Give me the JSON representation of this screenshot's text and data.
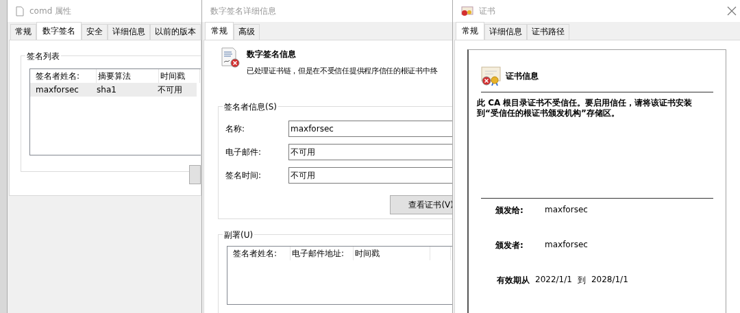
{
  "properties_window": {
    "title": "comd 属性",
    "tabs": [
      {
        "label": "常规",
        "selected": false
      },
      {
        "label": "数字签名",
        "selected": true
      },
      {
        "label": "安全",
        "selected": false
      },
      {
        "label": "详细信息",
        "selected": false
      },
      {
        "label": "以前的版本",
        "selected": false
      }
    ],
    "group_title": "签名列表",
    "signature_list": {
      "columns": [
        "签名者姓名:",
        "摘要算法",
        "时间戳"
      ],
      "rows": [
        {
          "cells": [
            "maxforsec",
            "sha1",
            "不可用"
          ],
          "selected": true
        }
      ]
    }
  },
  "details_window": {
    "title": "数字签名详细信息",
    "tabs": [
      {
        "label": "常规",
        "selected": true
      },
      {
        "label": "高级",
        "selected": false
      }
    ],
    "heading": "数字签名信息",
    "message": "已处理证书链，但是在不受信任提供程序信任的根证书中终",
    "signer_group": "签名者信息(S)",
    "fields": [
      {
        "label": "名称:",
        "value": "maxforsec"
      },
      {
        "label": "电子邮件:",
        "value": "不可用"
      },
      {
        "label": "签名时间:",
        "value": "不可用"
      }
    ],
    "view_button": "查看证书(V)",
    "countersign_group": "副署(U)",
    "countersign_columns": [
      "签名者姓名:",
      "电子邮件地址:",
      "时间戳"
    ]
  },
  "certificate_window": {
    "title": "证书",
    "tabs": [
      {
        "label": "常规",
        "selected": true
      },
      {
        "label": "详细信息",
        "selected": false
      },
      {
        "label": "证书路径",
        "selected": false
      }
    ],
    "heading": "证书信息",
    "message": "此 CA 根目录证书不受信任。要启用信任，请将该证书安装到“受信任的根证书颁发机构”存储区。",
    "issued_to_label": "颁发给:",
    "issued_to": "maxforsec",
    "issued_by_label": "颁发者:",
    "issued_by": "maxforsec",
    "valid_from_label": "有效期从",
    "valid_from": "2022/1/1",
    "valid_to_label": "到",
    "valid_to": "2028/1/1"
  }
}
